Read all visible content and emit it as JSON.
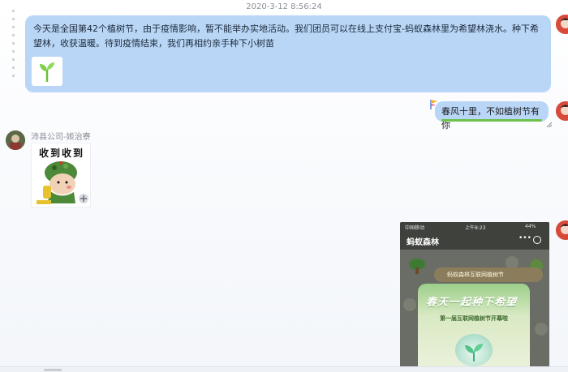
{
  "chat": {
    "timestamp": "2020-3-12 8:56:24",
    "messages": [
      {
        "id": "m1",
        "side": "right",
        "text": "今天是全国第42个植树节，由于疫情影响，暂不能举办实地活动。我们团员可以在线上支付宝-蚂蚁森林里为希望林浇水。种下希望林，收获温暖。待到疫情结束，我们再相约亲手种下小树苗",
        "attachment_icon": "sapling-icon"
      },
      {
        "id": "m2",
        "side": "right",
        "text": "春风十里，不如植树节有你"
      },
      {
        "id": "m3",
        "side": "left",
        "sender": "沛县公司-姬治寮",
        "sticker_caption": "收到收到"
      },
      {
        "id": "m4",
        "side": "right",
        "screenshot": {
          "carrier": "中国移动",
          "time": "上午8:23",
          "battery": "44%",
          "app_title": "蚂蚁森林",
          "menu_dots": "•••",
          "banner": "蚂蚁森林互联网植树节",
          "headline": "春天一起种下希望",
          "subheadline": "第一届互联网植树节开幕啦"
        }
      }
    ]
  },
  "colors": {
    "bubble_self": "#b9d6f7",
    "accent_green": "#6cc24a",
    "avatar_self": "#d74a3a"
  }
}
